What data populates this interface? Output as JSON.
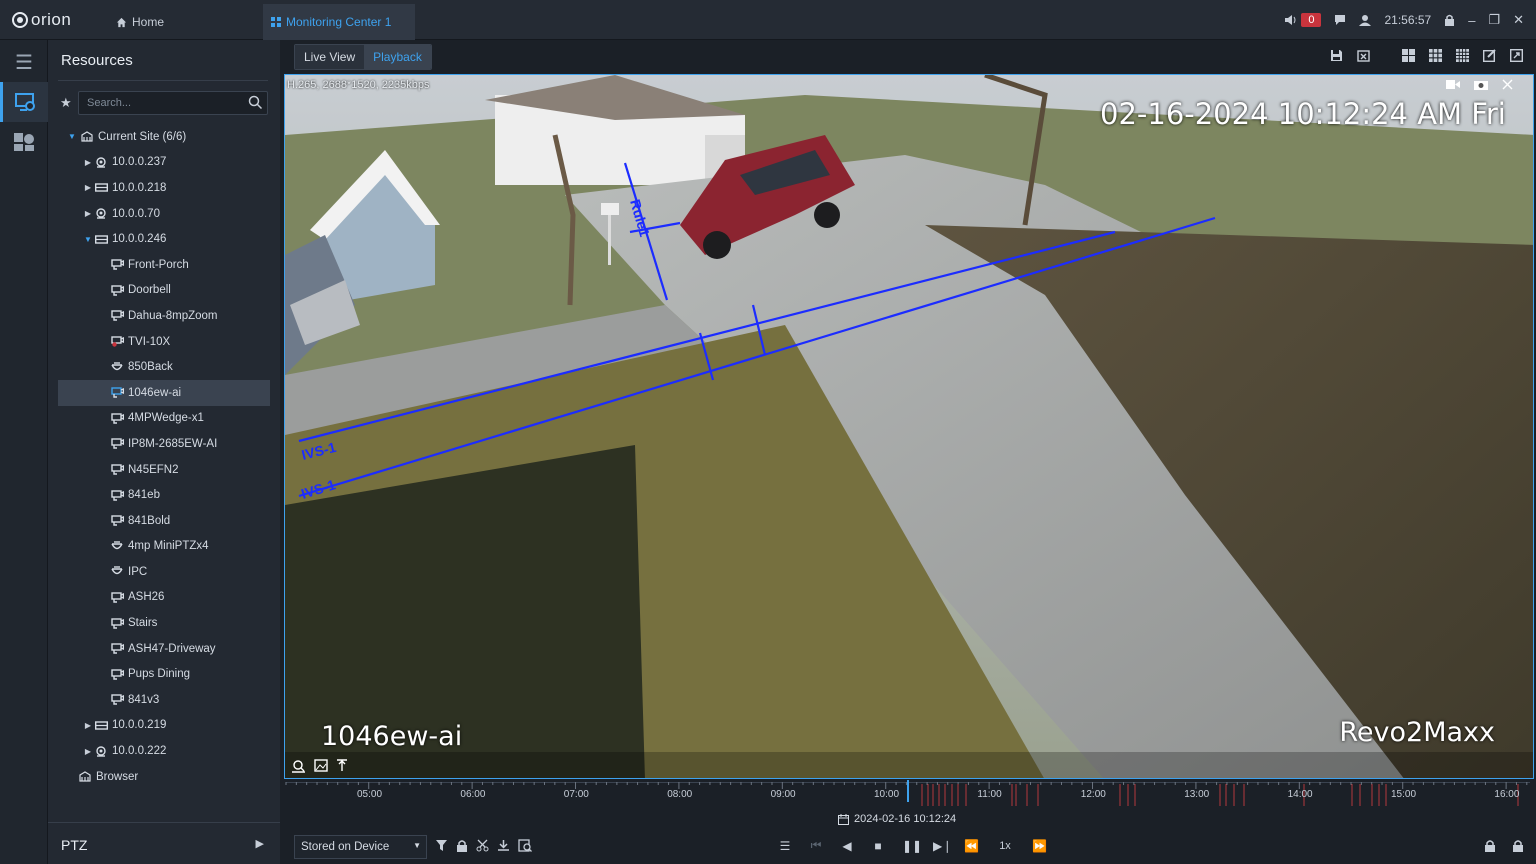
{
  "app": {
    "logo": "orion"
  },
  "topbar": {
    "home_label": "Home",
    "tab_label": "Monitoring Center 1",
    "alarm_count": "0",
    "clock": "21:56:57"
  },
  "resources": {
    "title": "Resources",
    "search_placeholder": "Search...",
    "tree": [
      {
        "label": "Current Site (6/6)",
        "level": 0,
        "icon": "site-icon",
        "expand": "open"
      },
      {
        "label": "10.0.0.237",
        "level": 1,
        "icon": "nvr-dome-icon",
        "expand": "closed"
      },
      {
        "label": "10.0.0.218",
        "level": 1,
        "icon": "nvr-box-icon",
        "expand": "closed"
      },
      {
        "label": "10.0.0.70",
        "level": 1,
        "icon": "nvr-dome-icon",
        "expand": "closed"
      },
      {
        "label": "10.0.0.246",
        "level": 1,
        "icon": "nvr-box-icon",
        "expand": "open"
      },
      {
        "label": "Front-Porch",
        "level": 2,
        "icon": "camera-icon"
      },
      {
        "label": "Doorbell",
        "level": 2,
        "icon": "camera-icon"
      },
      {
        "label": "Dahua-8mpZoom",
        "level": 2,
        "icon": "camera-icon"
      },
      {
        "label": "TVI-10X",
        "level": 2,
        "icon": "camera-alert-icon"
      },
      {
        "label": "850Back",
        "level": 2,
        "icon": "dome-camera-icon"
      },
      {
        "label": "1046ew-ai",
        "level": 2,
        "icon": "camera-live-icon",
        "selected": true
      },
      {
        "label": "4MPWedge-x1",
        "level": 2,
        "icon": "camera-icon"
      },
      {
        "label": "IP8M-2685EW-AI",
        "level": 2,
        "icon": "camera-icon"
      },
      {
        "label": "N45EFN2",
        "level": 2,
        "icon": "camera-icon"
      },
      {
        "label": "841eb",
        "level": 2,
        "icon": "camera-icon"
      },
      {
        "label": "841Bold",
        "level": 2,
        "icon": "camera-icon"
      },
      {
        "label": "4mp MiniPTZx4",
        "level": 2,
        "icon": "dome-camera-icon"
      },
      {
        "label": "IPC",
        "level": 2,
        "icon": "dome-camera-icon"
      },
      {
        "label": "ASH26",
        "level": 2,
        "icon": "camera-icon"
      },
      {
        "label": "Stairs",
        "level": 2,
        "icon": "camera-icon"
      },
      {
        "label": "ASH47-Driveway",
        "level": 2,
        "icon": "camera-icon"
      },
      {
        "label": "Pups Dining",
        "level": 2,
        "icon": "camera-icon"
      },
      {
        "label": "841v3",
        "level": 2,
        "icon": "camera-icon"
      },
      {
        "label": "10.0.0.219",
        "level": 1,
        "icon": "nvr-box-icon",
        "expand": "closed"
      },
      {
        "label": "10.0.0.222",
        "level": 1,
        "icon": "nvr-dome-icon",
        "expand": "closed"
      },
      {
        "label": "Browser",
        "level": 0,
        "icon": "site-icon"
      }
    ],
    "ptz_label": "PTZ"
  },
  "main": {
    "tabs": [
      {
        "label": "Live View",
        "active": false
      },
      {
        "label": "Playback",
        "active": true
      }
    ],
    "video": {
      "stream_info": "H.265, 2688*1520, 2235kbps",
      "osd_time": "02-16-2024 10:12:24 AM Fri",
      "osd_name": "1046ew-ai",
      "osd_brand": "Revo2Maxx",
      "rule_labels": [
        "Rule1",
        "IVS-1",
        "IVS-1"
      ]
    },
    "timeline": {
      "ticks": [
        "05:00",
        "06:00",
        "07:00",
        "08:00",
        "09:00",
        "10:00",
        "11:00",
        "12:00",
        "13:00",
        "14:00",
        "15:00",
        "16:00"
      ],
      "current": "2024-02-16 10:12:24"
    },
    "controls": {
      "storage": "Stored on Device",
      "speed": "1x"
    }
  },
  "colors": {
    "accent": "#3ea2ee",
    "alarm": "#c9343d",
    "rule_line": "#1c2cff",
    "record_mark": "#b3373d"
  }
}
